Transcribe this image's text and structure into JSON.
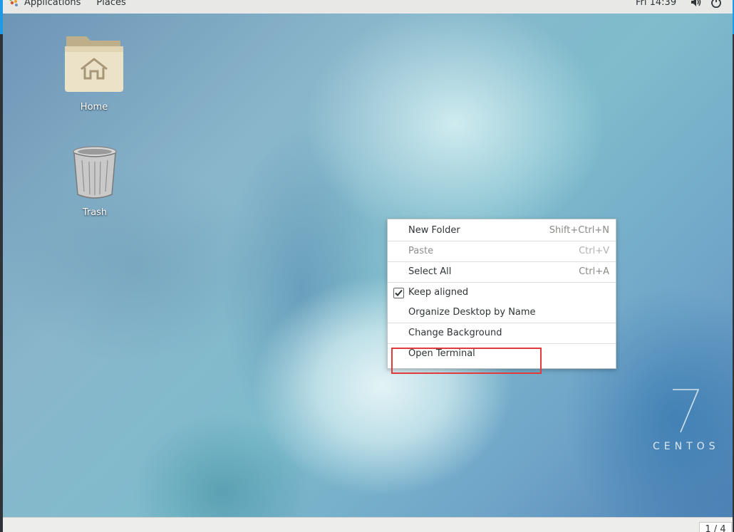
{
  "top_panel": {
    "applications_label": "Applications",
    "places_label": "Places",
    "clock": "Fri 14:39",
    "icons": [
      "apps-logo-icon",
      "volume-icon",
      "power-icon"
    ]
  },
  "desktop": {
    "icons": [
      {
        "label": "Home",
        "icon": "home-folder-icon"
      },
      {
        "label": "Trash",
        "icon": "trash-icon"
      }
    ],
    "branding": {
      "number": "7",
      "text": "CENTOS"
    }
  },
  "context_menu": {
    "items": [
      {
        "label": "New Folder",
        "accel": "Shift+Ctrl+N"
      },
      {
        "label": "Paste",
        "accel": "Ctrl+V",
        "disabled": true
      },
      {
        "label": "Select All",
        "accel": "Ctrl+A"
      },
      {
        "label": "Keep aligned",
        "checked": true
      },
      {
        "label": "Organize Desktop by Name"
      },
      {
        "label": "Change Background"
      },
      {
        "label": "Open Terminal",
        "highlighted": true
      }
    ]
  },
  "bottom_panel": {
    "workspace_indicator": "1 / 4"
  },
  "colors": {
    "highlight": "#e23a3a",
    "accent": "#1f98e6"
  }
}
